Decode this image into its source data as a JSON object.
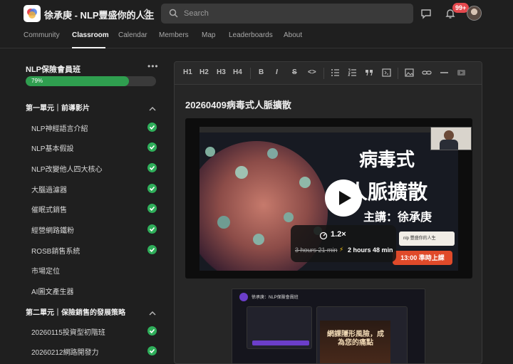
{
  "topbar": {
    "group_name": "徐承庚 - NLP豐盛你的人生",
    "search_placeholder": "Search",
    "notification_count": "99+",
    "icons": [
      "logo-icon",
      "switcher-icon",
      "search-icon",
      "chat-icon",
      "bell-icon",
      "avatar"
    ]
  },
  "nav": {
    "tabs": [
      {
        "label": "Community"
      },
      {
        "label": "Classroom"
      },
      {
        "label": "Calendar"
      },
      {
        "label": "Members"
      },
      {
        "label": "Map"
      },
      {
        "label": "Leaderboards"
      },
      {
        "label": "About"
      }
    ],
    "active": "Classroom"
  },
  "course": {
    "title": "NLP保險會員班",
    "progress_percent": 79,
    "progress_label": "79%",
    "modules": [
      {
        "title": "第一單元｜前導影片",
        "lessons": [
          {
            "label": "NLP神經語言介紹",
            "done": true
          },
          {
            "label": "NLP基本假設",
            "done": true
          },
          {
            "label": "NLP改變他人四大核心",
            "done": true
          },
          {
            "label": "大腦過濾器",
            "done": true
          },
          {
            "label": "催眠式銷售",
            "done": true
          },
          {
            "label": "經營網路鐵粉",
            "done": true
          },
          {
            "label": "ROSB銷售系統",
            "done": true
          },
          {
            "label": "市場定位",
            "done": false
          },
          {
            "label": "AI圖文產生器",
            "done": false
          }
        ]
      },
      {
        "title": "第二單元｜保險銷售的發展策略",
        "lessons": [
          {
            "label": "20260115投資型初階班",
            "done": true
          },
          {
            "label": "20260212網路開發力",
            "done": true
          }
        ]
      }
    ]
  },
  "editor": {
    "toolbar": [
      "H1",
      "H2",
      "H3",
      "H4",
      "B",
      "I",
      "S",
      "<>"
    ],
    "post_title": "20260409病毒式人脈擴散"
  },
  "video": {
    "slide_title_line1": "病毒式",
    "slide_title_line2": "人脈擴散",
    "speaker": "主講：徐承庚",
    "tag": "nlp 豐盛你的人生",
    "time_tag": "13:00 準時上課",
    "speed": "1.2×",
    "original_duration": "3 hours 21 min",
    "new_duration": "2 hours 48 min"
  },
  "thumbnail": {
    "header": "徐承庚：NLP保險會員班",
    "promo_text": "網課隱形風險，成為您的痛點"
  },
  "colors": {
    "accent": "#2fae5a",
    "progress": "#2f9e4f",
    "badge": "#e5484d",
    "time_chip": "#e04a2a"
  }
}
